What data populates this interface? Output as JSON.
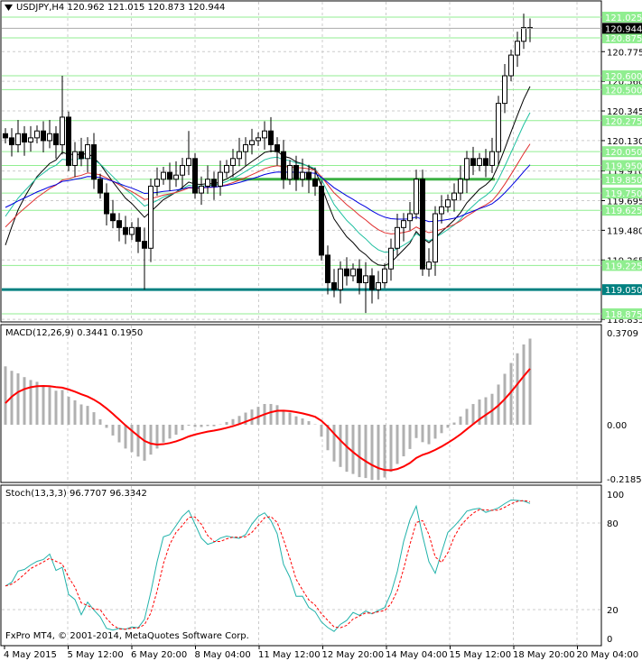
{
  "main_header": "USDJPY,H4  120.962 121.015 120.873 120.944",
  "macd_header": "MACD(12,26,9) 0.3441 0.1950",
  "stoch_header": "Stoch(13,3,3) 96.7707 96.3342",
  "copyright": "FxPro MT4, © 2001-2014, MetaQuotes Software Corp.",
  "colors": {
    "bull": "#ffffff",
    "bear": "#000000",
    "level": "#90ee90",
    "support": "#008080",
    "signal": "#ff0000",
    "hist": "#b0b0b0",
    "stoch_k": "#20b2aa",
    "stoch_d": "#ff0000"
  },
  "chart_data": [
    {
      "type": "candlestick",
      "symbol": "USDJPY,H4",
      "ylim": [
        118.835,
        121.09
      ],
      "price_ticks": [
        "120.775",
        "120.560",
        "120.345",
        "120.130",
        "119.910",
        "119.695",
        "119.480",
        "119.265",
        "118.835"
      ],
      "level_labels": [
        "121.025",
        "120.875",
        "120.600",
        "120.500",
        "120.275",
        "120.050",
        "119.950",
        "119.850",
        "119.750",
        "119.625",
        "119.225",
        "118.875"
      ],
      "support_label": "119.050",
      "current_price": "120.944",
      "resistance_line": 119.85,
      "closes": [
        120.15,
        120.1,
        120.18,
        120.12,
        120.15,
        120.2,
        120.13,
        120.18,
        120.1,
        120.3,
        119.95,
        120.05,
        120.0,
        120.1,
        119.85,
        119.75,
        119.6,
        119.55,
        119.5,
        119.45,
        119.5,
        119.4,
        119.35,
        119.8,
        119.85,
        119.9,
        119.85,
        119.88,
        119.95,
        120.0,
        119.75,
        119.8,
        119.85,
        119.8,
        119.9,
        119.95,
        120.0,
        120.05,
        120.1,
        120.13,
        120.15,
        120.2,
        120.1,
        120.05,
        119.85,
        119.95,
        119.85,
        119.9,
        119.85,
        119.8,
        119.3,
        119.1,
        119.05,
        119.2,
        119.15,
        119.2,
        119.1,
        119.15,
        119.05,
        119.1,
        119.2,
        119.35,
        119.5,
        119.55,
        119.6,
        119.85,
        119.2,
        119.25,
        119.6,
        119.65,
        119.7,
        119.75,
        119.85,
        120.0,
        119.95,
        120.0,
        119.95,
        120.05,
        120.4,
        120.6,
        120.75,
        120.85,
        120.95,
        120.944
      ],
      "x_labels": [
        "4 May 2015",
        "5 May 12:00",
        "6 May 20:00",
        "8 May 04:00",
        "11 May 12:00",
        "12 May 20:00",
        "14 May 04:00",
        "15 May 12:00",
        "18 May 20:00",
        "20 May 04:00"
      ]
    },
    {
      "type": "bar+line",
      "name": "MACD",
      "ticks": [
        "0.3709",
        "0.00",
        "-0.2185"
      ],
      "ylim": [
        -0.2185,
        0.3709
      ]
    },
    {
      "type": "line",
      "name": "Stoch",
      "ticks": [
        "100",
        "80",
        "20",
        "0"
      ],
      "ylim": [
        0,
        100
      ]
    }
  ]
}
